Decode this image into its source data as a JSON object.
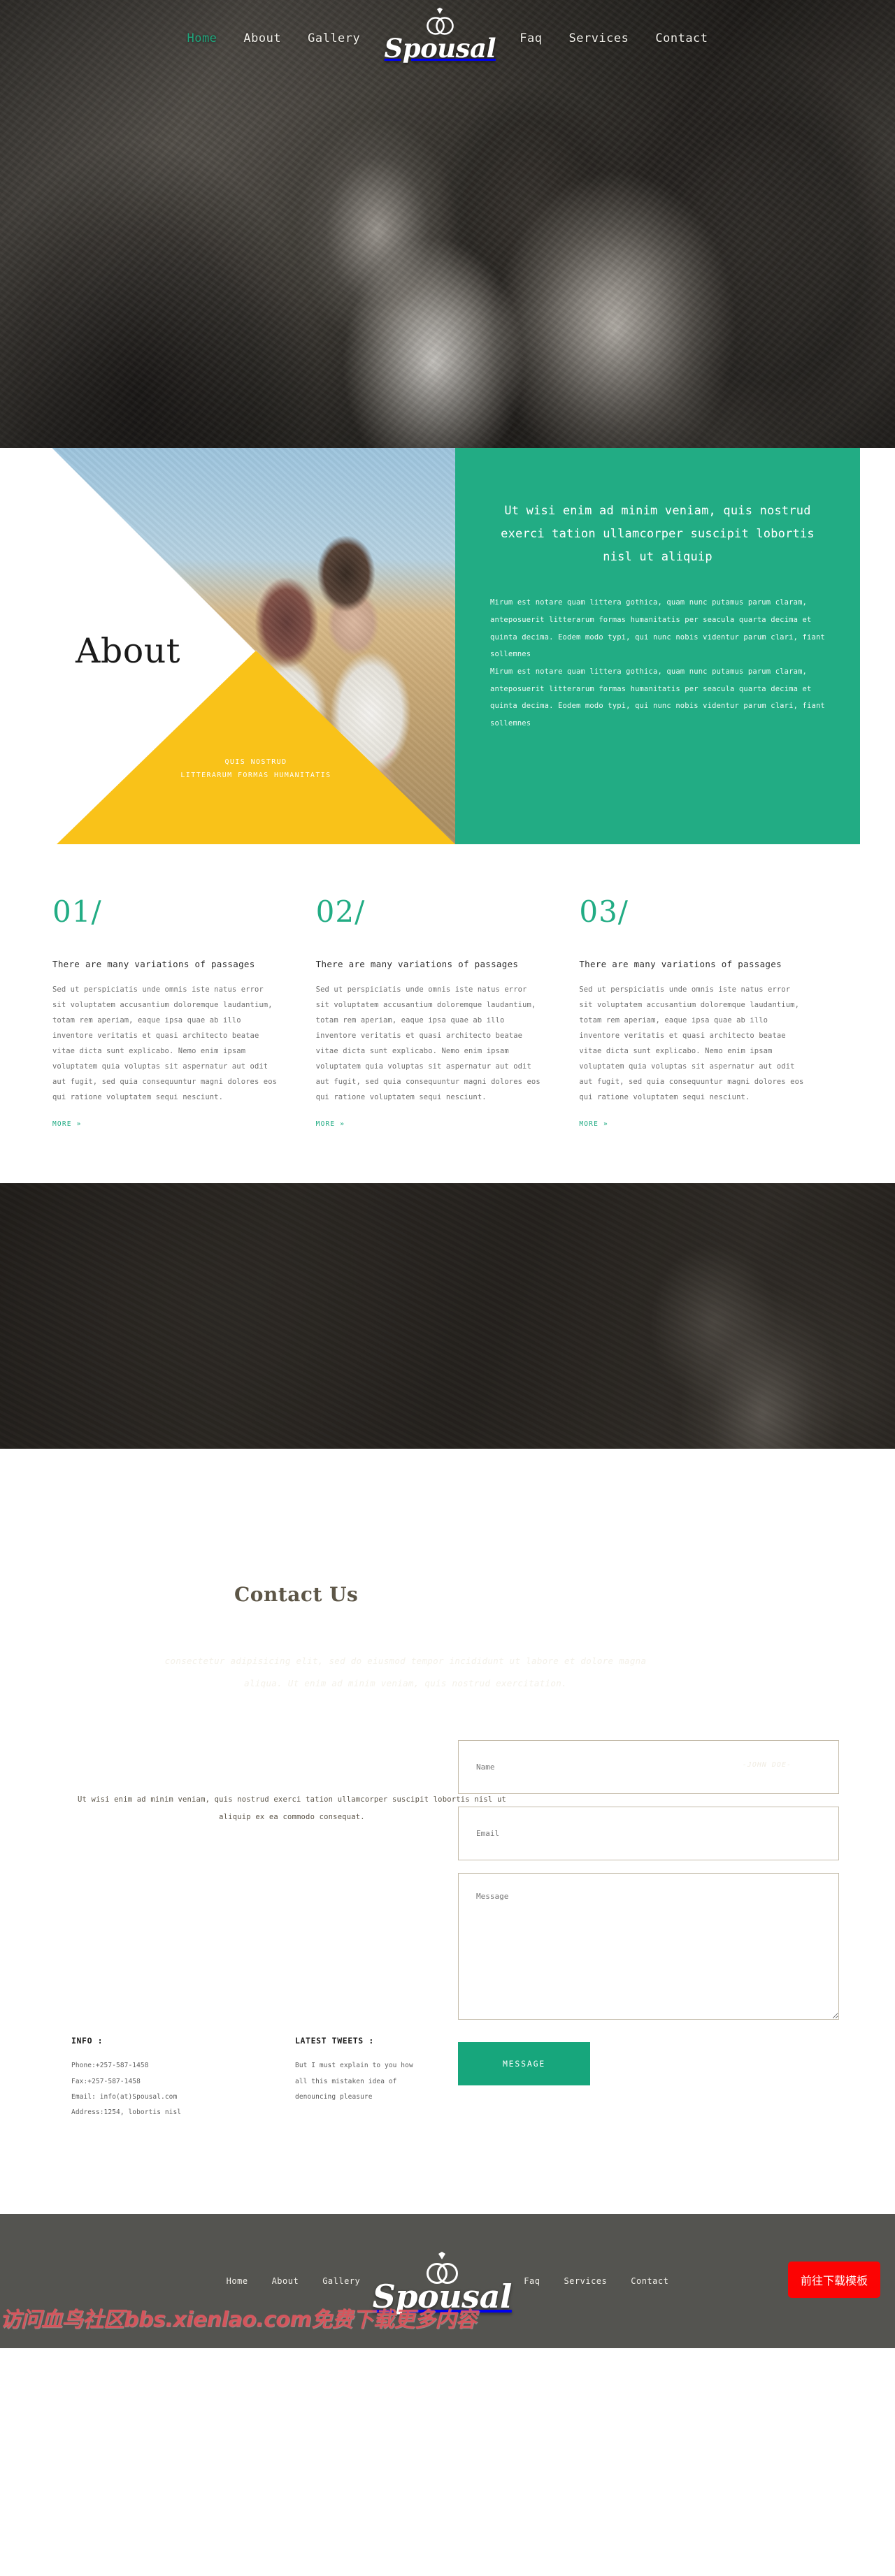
{
  "brand": {
    "name": "Spousal",
    "icon": "wedding-rings-icon"
  },
  "nav": {
    "left": [
      {
        "label": "Home",
        "active": true
      },
      {
        "label": "About",
        "active": false
      },
      {
        "label": "Gallery",
        "active": false
      }
    ],
    "right": [
      {
        "label": "Faq"
      },
      {
        "label": "Services"
      },
      {
        "label": "Contact"
      }
    ]
  },
  "about": {
    "heading": "About",
    "yellow_caption_line1": "QUIS NOSTRUD",
    "yellow_caption_line2": "LITTERARUM FORMAS HUMANITATIS",
    "lead": "Ut wisi enim ad minim veniam, quis nostrud exerci tation ullamcorper suscipit lobortis nisl ut aliquip",
    "paragraph1": "Mirum est notare quam littera gothica, quam nunc putamus parum claram, anteposuerit litterarum formas humanitatis per seacula quarta decima et quinta decima. Eodem modo typi, qui nunc nobis videntur parum clari, fiant sollemnes",
    "paragraph2": "Mirum est notare quam littera gothica, quam nunc putamus parum claram, anteposuerit litterarum formas humanitatis per seacula quarta decima et quinta decima. Eodem modo typi, qui nunc nobis videntur parum clari, fiant sollemnes"
  },
  "features": [
    {
      "number": "01/",
      "title": "There are many variations of passages",
      "text": "Sed ut perspiciatis unde omnis iste natus error sit voluptatem accusantium doloremque laudantium, totam rem aperiam, eaque ipsa quae ab illo inventore veritatis et quasi architecto beatae vitae dicta sunt explicabo. Nemo enim ipsam voluptatem quia voluptas sit aspernatur aut odit aut fugit, sed quia consequuntur magni dolores eos qui ratione voluptatem sequi nesciunt.",
      "more": "MORE »"
    },
    {
      "number": "02/",
      "title": "There are many variations of passages",
      "text": "Sed ut perspiciatis unde omnis iste natus error sit voluptatem accusantium doloremque laudantium, totam rem aperiam, eaque ipsa quae ab illo inventore veritatis et quasi architecto beatae vitae dicta sunt explicabo. Nemo enim ipsam voluptatem quia voluptas sit aspernatur aut odit aut fugit, sed quia consequuntur magni dolores eos qui ratione voluptatem sequi nesciunt.",
      "more": "MORE »"
    },
    {
      "number": "03/",
      "title": "There are many variations of passages",
      "text": "Sed ut perspiciatis unde omnis iste natus error sit voluptatem accusantium doloremque laudantium, totam rem aperiam, eaque ipsa quae ab illo inventore veritatis et quasi architecto beatae vitae dicta sunt explicabo. Nemo enim ipsam voluptatem quia voluptas sit aspernatur aut odit aut fugit, sed quia consequuntur magni dolores eos qui ratione voluptatem sequi nesciunt.",
      "more": "MORE »"
    }
  ],
  "quote": {
    "open_mark": "“",
    "close_mark": "”",
    "text": "consectetur adipisicing elit, sed do eiusmod tempor incididunt ut labore et dolore magna aliqua. Ut enim ad minim veniam, quis nostrud exercitation.",
    "author": "-JOHN DOE-"
  },
  "contact": {
    "title": "Contact Us",
    "lead": "Ut wisi enim ad minim veniam, quis nostrud exerci tation ullamcorper suscipit lobortis nisl ut aliquip ex ea commodo consequat.",
    "info": {
      "heading": "INFO :",
      "phone": "Phone:+257-587-1458",
      "fax": "Fax:+257-587-1458",
      "email": "Email: info(at)Spousal.com",
      "address": "Address:1254, lobortis nisl"
    },
    "tweets": {
      "heading": "LATEST TWEETS :",
      "line1": "But I must explain to you how",
      "line2": "all this mistaken idea of",
      "line3": "denouncing pleasure"
    },
    "form": {
      "name_placeholder": "Name",
      "email_placeholder": "Email",
      "message_placeholder": "Message",
      "submit_label": "MESSAGE"
    }
  },
  "footer": {
    "nav_left": [
      {
        "label": "Home"
      },
      {
        "label": "About"
      },
      {
        "label": "Gallery"
      }
    ],
    "nav_right": [
      {
        "label": "Faq"
      },
      {
        "label": "Services"
      },
      {
        "label": "Contact"
      }
    ],
    "brand": "Spousal",
    "watermark": "访问血鸟社区bbs.xienlao.com免费下载更多内容",
    "download_button": "前往下载模板"
  },
  "colors": {
    "accent_green": "#22ac84",
    "accent_yellow": "#f9c219",
    "footer_bg": "#545450",
    "download_red": "#fc0303"
  }
}
